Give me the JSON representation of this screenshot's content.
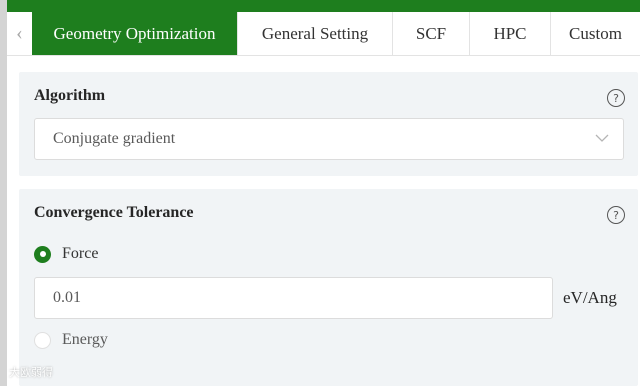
{
  "tabs": [
    {
      "label": "Geometry Optimization",
      "active": true
    },
    {
      "label": "General Setting",
      "active": false
    },
    {
      "label": "SCF",
      "active": false
    },
    {
      "label": "HPC",
      "active": false
    },
    {
      "label": "Custom",
      "active": false
    }
  ],
  "tab_scroll_left_glyph": "‹",
  "colors": {
    "accent": "#1e7e1e",
    "panel_bg": "#f1f4f6"
  },
  "algorithm": {
    "title": "Algorithm",
    "help_glyph": "?",
    "selected": "Conjugate gradient"
  },
  "convergence": {
    "title": "Convergence Tolerance",
    "help_glyph": "?",
    "options": [
      {
        "label": "Force",
        "checked": true
      },
      {
        "label": "Energy",
        "checked": false
      }
    ],
    "force_value": "0.01",
    "unit": "eV/Ang"
  },
  "watermark": "大欧弱得"
}
